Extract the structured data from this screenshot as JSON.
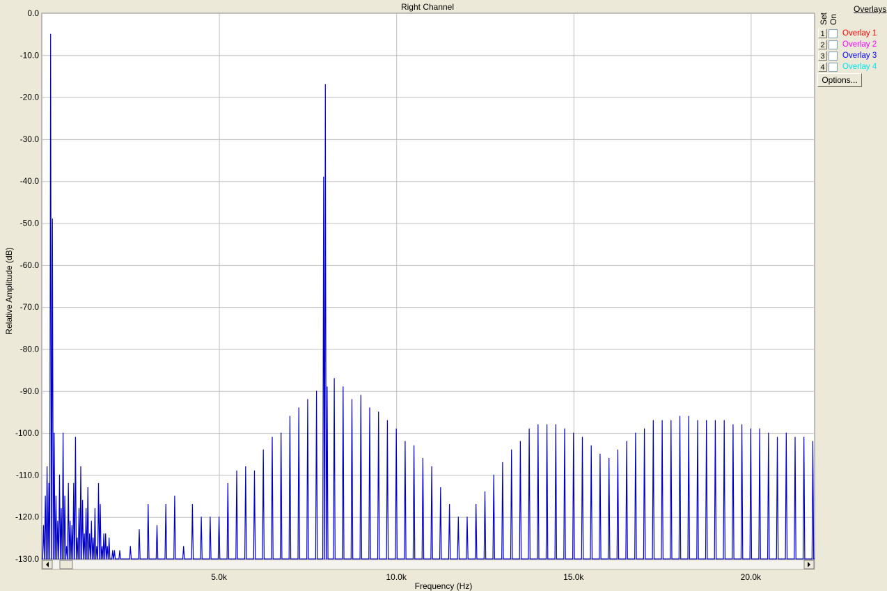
{
  "chart_data": {
    "type": "line",
    "title": "Right Channel",
    "xlabel": "Frequency (Hz)",
    "ylabel": "Relative Amplitude (dB)",
    "xlim": [
      0,
      21800
    ],
    "ylim": [
      -130,
      0
    ],
    "grid": true,
    "x_ticks": [
      5000,
      10000,
      15000,
      20000
    ],
    "x_tick_labels": [
      "5.0k",
      "10.0k",
      "15.0k",
      "20.0k"
    ],
    "y_ticks": [
      0,
      -10,
      -20,
      -30,
      -40,
      -50,
      -60,
      -70,
      -80,
      -90,
      -100,
      -110,
      -120,
      -130
    ],
    "y_tick_labels": [
      "0.0",
      "-10.0",
      "-20.0",
      "-30.0",
      "-40.0",
      "-50.0",
      "-60.0",
      "-70.0",
      "-80.0",
      "-90.0",
      "-100.0",
      "-110.0",
      "-120.0",
      "-130.0"
    ],
    "series": [
      {
        "color": "#0000c8",
        "baseline": -130,
        "peaks_x": [
          50,
          100,
          150,
          200,
          250,
          300,
          350,
          400,
          450,
          500,
          550,
          600,
          650,
          700,
          750,
          800,
          850,
          900,
          950,
          1000,
          1050,
          1100,
          1150,
          1200,
          1250,
          1300,
          1350,
          1400,
          1450,
          1500,
          1550,
          1600,
          1650,
          1700,
          1750,
          1800,
          1850,
          1900,
          2000,
          2050,
          2200,
          2500,
          2750,
          3000,
          3250,
          3500,
          3750,
          4000,
          4250,
          4500,
          4750,
          5000,
          5250,
          5500,
          5750,
          6000,
          6250,
          6500,
          6750,
          7000,
          7250,
          7500,
          7750,
          7950,
          8000,
          8050,
          8250,
          8500,
          8750,
          9000,
          9250,
          9500,
          9750,
          10000,
          10250,
          10500,
          10750,
          11000,
          11250,
          11500,
          11750,
          12000,
          12250,
          12500,
          12750,
          13000,
          13250,
          13500,
          13750,
          14000,
          14250,
          14500,
          14750,
          15000,
          15250,
          15500,
          15750,
          16000,
          16250,
          16500,
          16750,
          17000,
          17250,
          17500,
          17750,
          18000,
          18250,
          18500,
          18750,
          19000,
          19250,
          19500,
          19750,
          20000,
          20250,
          20500,
          20750,
          21000,
          21250,
          21500,
          21750
        ],
        "peaks_y": [
          -122,
          -115,
          -108,
          -112,
          -5,
          -49,
          -100,
          -115,
          -121,
          -110,
          -118,
          -100,
          -115,
          -127,
          -112,
          -121,
          -122,
          -112,
          -101,
          -125,
          -118,
          -108,
          -116,
          -124,
          -118,
          -113,
          -124,
          -121,
          -125,
          -118,
          -127,
          -112,
          -117,
          -127,
          -124,
          -124,
          -127,
          -125,
          -128,
          -128,
          -128,
          -127,
          -123,
          -117,
          -122,
          -117,
          -115,
          -127,
          -117,
          -120,
          -120,
          -120,
          -112,
          -109,
          -108,
          -109,
          -104,
          -101,
          -100,
          -96,
          -94,
          -92,
          -90,
          -39,
          -17,
          -89,
          -87,
          -89,
          -92,
          -91,
          -94,
          -95,
          -97,
          -99,
          -102,
          -103,
          -106,
          -108,
          -113,
          -117,
          -120,
          -120,
          -117,
          -114,
          -110,
          -107,
          -104,
          -102,
          -99,
          -98,
          -98,
          -98,
          -99,
          -100,
          -101,
          -103,
          -105,
          -106,
          -104,
          -102,
          -100,
          -99,
          -97,
          -97,
          -97,
          -96,
          -96,
          -97,
          -97,
          -97,
          -97,
          -98,
          -98,
          -99,
          -99,
          -100,
          -101,
          -100,
          -101,
          -101,
          -102,
          -102
        ]
      }
    ]
  },
  "overlays": {
    "title": "Overlays",
    "set_label": "Set",
    "on_label": "On",
    "items": [
      {
        "num": "1",
        "label": "Overlay 1",
        "color": "#ff0000"
      },
      {
        "num": "2",
        "label": "Overlay 2",
        "color": "#ff00ff"
      },
      {
        "num": "3",
        "label": "Overlay 3",
        "color": "#0000ff"
      },
      {
        "num": "4",
        "label": "Overlay 4",
        "color": "#00e5ee"
      }
    ],
    "options_label": "Options..."
  }
}
